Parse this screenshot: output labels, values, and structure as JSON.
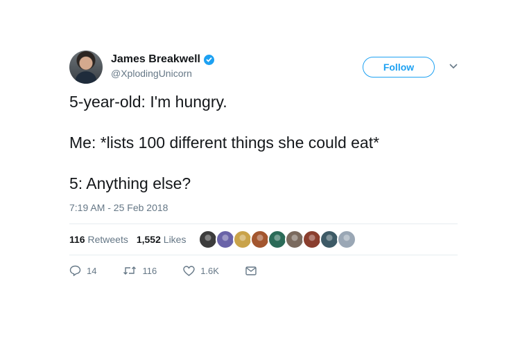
{
  "author": {
    "display_name": "James Breakwell",
    "handle": "@XplodingUnicorn",
    "verified": true
  },
  "follow_label": "Follow",
  "tweet_lines": [
    "5-year-old: I'm hungry.",
    "Me: *lists 100 different things she could eat*",
    "5: Anything else?"
  ],
  "timestamp": "7:19 AM - 25 Feb 2018",
  "stats": {
    "retweets_count": "116",
    "retweets_label": "Retweets",
    "likes_count": "1,552",
    "likes_label": "Likes"
  },
  "liker_avatar_colors": [
    "#3c3c3c",
    "#6a63a8",
    "#c9a34a",
    "#a3562f",
    "#2b6b58",
    "#7a6a5e",
    "#8a3e2e",
    "#3d5a66",
    "#9aa7b5"
  ],
  "actions": {
    "reply_count": "14",
    "retweet_count": "116",
    "like_count": "1.6K"
  },
  "colors": {
    "accent": "#1da1f2",
    "text_primary": "#14171a",
    "text_secondary": "#657786",
    "divider": "#e6ecf0"
  }
}
